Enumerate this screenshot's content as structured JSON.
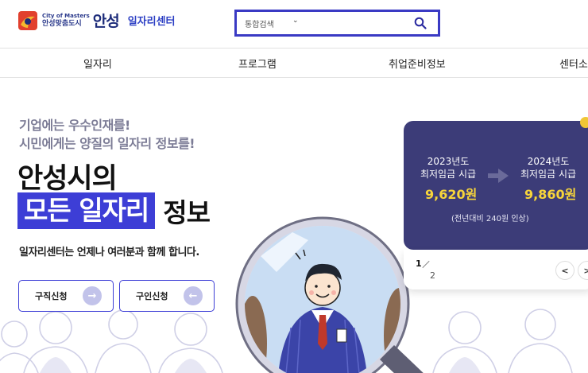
{
  "header": {
    "logo_small1": "City of Masters",
    "logo_small2": "안성맞춤도시",
    "logo_big": "안성",
    "site_name": "일자리센터",
    "search_select": "통합검색"
  },
  "nav": [
    "일자리",
    "프로그램",
    "취업준비정보",
    "센터소개"
  ],
  "hero": {
    "tagline1": "기업에는 우수인재를!",
    "tagline2": "시민에게는 양질의 일자리 정보를!",
    "headline1": "안성시의",
    "headline_highlight": "모든 일자리",
    "headline_rest": "정보",
    "description": "일자리센터는 언제나 여러분과 함께 합니다.",
    "btn_job_seek": "구직신청",
    "btn_job_offer": "구인신청"
  },
  "wage_card": {
    "left_year": "2023년도",
    "left_label": "최저임금 시급",
    "left_amount": "9,620원",
    "right_year": "2024년도",
    "right_label": "최저임금 시급",
    "right_amount": "9,860원",
    "note": "(전년대비 240원 인상)",
    "page_current": "1",
    "page_total": "2",
    "prev_symbol": "<",
    "next_symbol": ">"
  },
  "colors": {
    "primary": "#3d3ed6",
    "card_bg": "#3c3c78",
    "amount": "#f7d53a"
  }
}
